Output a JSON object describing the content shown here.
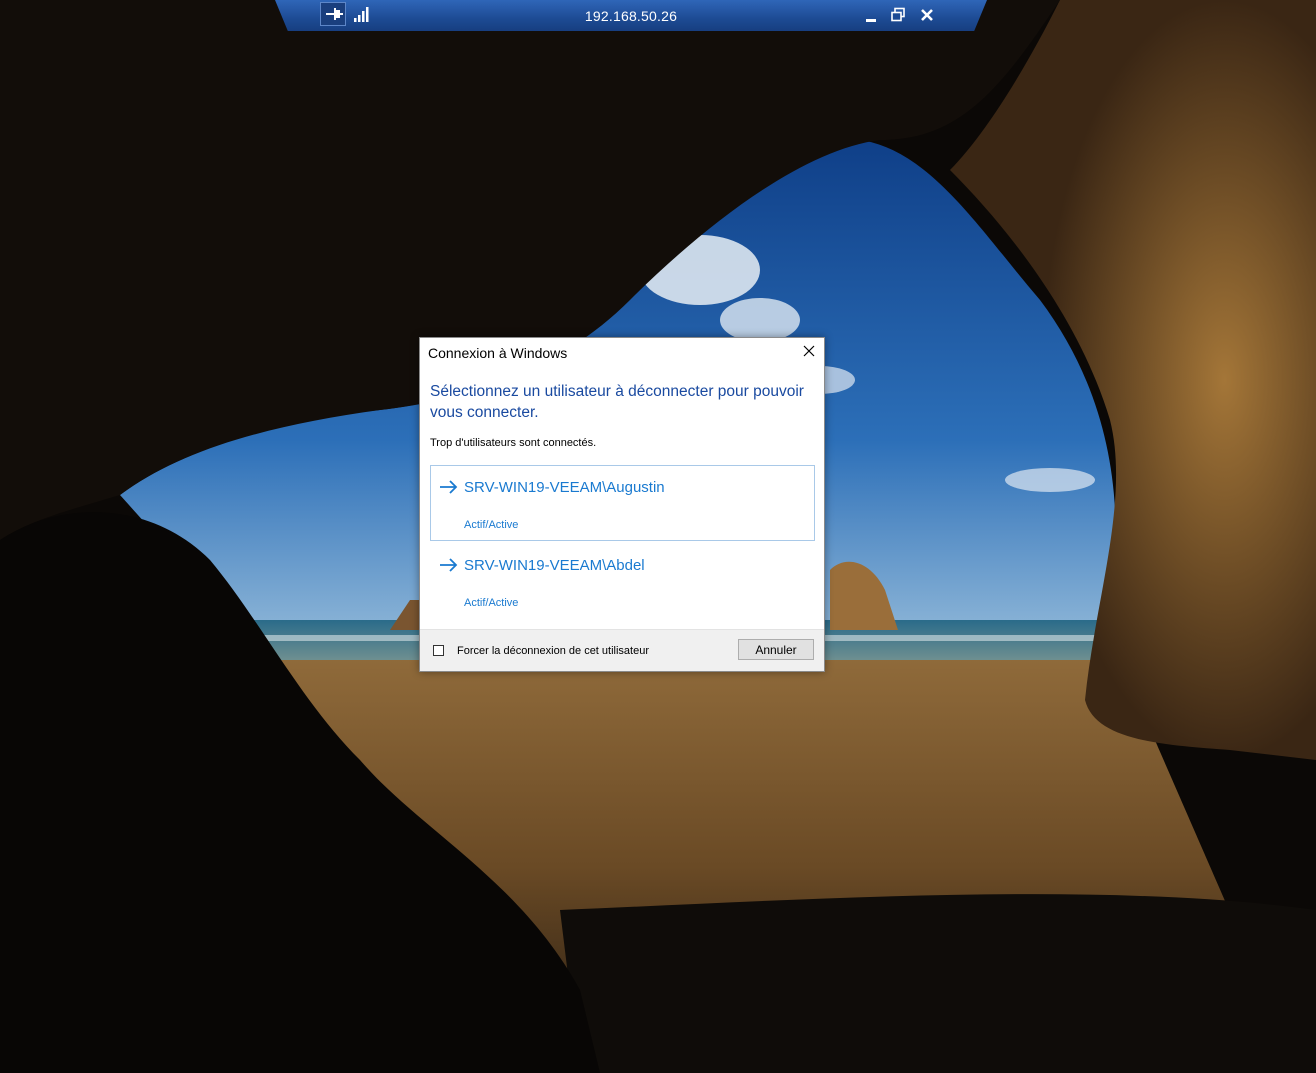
{
  "rdp_bar": {
    "host": "192.168.50.26",
    "pin_icon": "pin-icon",
    "signal_icon": "signal-strength-icon",
    "minimize_icon": "minimize-icon",
    "restore_icon": "restore-icon",
    "close_icon": "close-icon",
    "color": "#1d4b94"
  },
  "dialog": {
    "title": "Connexion à Windows",
    "heading": "Sélectionnez un utilisateur à déconnecter pour pouvoir vous connecter.",
    "subtext": "Trop d'utilisateurs sont connectés.",
    "users": [
      {
        "name": "SRV-WIN19-VEEAM\\Augustin",
        "status": "Actif/Active",
        "selected": true
      },
      {
        "name": "SRV-WIN19-VEEAM\\Abdel",
        "status": "Actif/Active",
        "selected": false
      }
    ],
    "force_checkbox_label": "Forcer la déconnexion de cet utilisateur",
    "force_checked": false,
    "cancel_label": "Annuler",
    "accent_color": "#1a7ad0",
    "heading_color": "#1a4aa0"
  }
}
